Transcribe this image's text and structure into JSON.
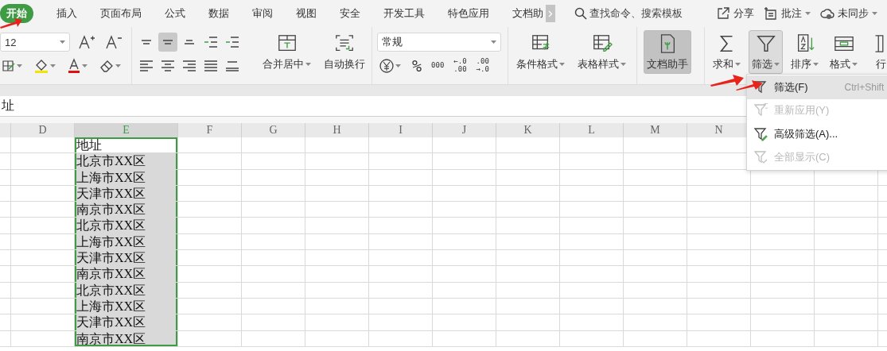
{
  "tabs": [
    {
      "label": "开始",
      "selected": true
    },
    {
      "label": "插入",
      "selected": false
    },
    {
      "label": "页面布局",
      "selected": false
    },
    {
      "label": "公式",
      "selected": false
    },
    {
      "label": "数据",
      "selected": false
    },
    {
      "label": "审阅",
      "selected": false
    },
    {
      "label": "视图",
      "selected": false
    },
    {
      "label": "安全",
      "selected": false
    },
    {
      "label": "开发工具",
      "selected": false
    },
    {
      "label": "特色应用",
      "selected": false
    },
    {
      "label": "文档助",
      "selected": false
    }
  ],
  "search": {
    "placeholder": "查找命令、搜索模板"
  },
  "top_actions": [
    {
      "kind": "share",
      "label": "分享",
      "dropdown": false
    },
    {
      "kind": "comment",
      "label": "批注",
      "dropdown": true
    },
    {
      "kind": "sync",
      "label": "未同步",
      "dropdown": true
    }
  ],
  "font_size": "12",
  "align_buttons": [
    {
      "kind": "top",
      "selected": false
    },
    {
      "kind": "middle",
      "selected": true
    },
    {
      "kind": "bottom",
      "selected": false
    },
    {
      "kind": "outdent",
      "selected": false
    },
    {
      "kind": "indent",
      "selected": false
    },
    {
      "kind": "left",
      "selected": false
    },
    {
      "kind": "center",
      "selected": false
    },
    {
      "kind": "right",
      "selected": false
    },
    {
      "kind": "justify",
      "selected": false
    },
    {
      "kind": "distribute",
      "selected": false
    }
  ],
  "number_format": "常规",
  "number_tools": [
    {
      "kind": "percent",
      "lines": [
        "%"
      ]
    },
    {
      "kind": "thousands",
      "lines": [
        "000"
      ]
    },
    {
      "kind": "more_decimals",
      "lines": [
        "←.0",
        ".00"
      ]
    },
    {
      "kind": "fewer_decimals",
      "lines": [
        ".00",
        "→.0"
      ]
    }
  ],
  "ribbon_buttons": [
    {
      "kind": "merge",
      "label": "合并居中",
      "dropdown": true,
      "selected": false
    },
    {
      "kind": "wrap",
      "label": "自动换行",
      "dropdown": false,
      "selected": false
    },
    {
      "kind": "conditional",
      "label": "条件格式",
      "dropdown": true,
      "selected": false
    },
    {
      "kind": "table_style",
      "label": "表格样式",
      "dropdown": true,
      "selected": false
    },
    {
      "kind": "assistant",
      "label": "文档助手",
      "dropdown": false,
      "selected": true
    },
    {
      "kind": "sum",
      "label": "求和",
      "dropdown": true,
      "selected": false
    },
    {
      "kind": "filter",
      "label": "筛选",
      "dropdown": true,
      "selected": true
    },
    {
      "kind": "sort",
      "label": "排序",
      "dropdown": true,
      "selected": false
    },
    {
      "kind": "format",
      "label": "格式",
      "dropdown": true,
      "selected": false
    },
    {
      "kind": "rows_cols",
      "label": "行",
      "dropdown": false,
      "selected": false
    }
  ],
  "formula_bar": {
    "value": "址"
  },
  "columns": [
    {
      "label": "D",
      "selected": false
    },
    {
      "label": "E",
      "selected": true
    },
    {
      "label": "F",
      "selected": false
    },
    {
      "label": "G",
      "selected": false
    },
    {
      "label": "H",
      "selected": false
    },
    {
      "label": "I",
      "selected": false
    },
    {
      "label": "J",
      "selected": false
    },
    {
      "label": "K",
      "selected": false
    },
    {
      "label": "L",
      "selected": false
    },
    {
      "label": "M",
      "selected": false
    },
    {
      "label": "N",
      "selected": false
    }
  ],
  "rows": [
    {
      "value": "地址",
      "selected": true,
      "active": true
    },
    {
      "value": "北京市XX区",
      "selected": true,
      "active": false
    },
    {
      "value": "上海市XX区",
      "selected": true,
      "active": false
    },
    {
      "value": "天津市XX区",
      "selected": true,
      "active": false
    },
    {
      "value": "南京市XX区",
      "selected": true,
      "active": false
    },
    {
      "value": "北京市XX区",
      "selected": true,
      "active": false
    },
    {
      "value": "上海市XX区",
      "selected": true,
      "active": false
    },
    {
      "value": "天津市XX区",
      "selected": true,
      "active": false
    },
    {
      "value": "南京市XX区",
      "selected": true,
      "active": false
    },
    {
      "value": "北京市XX区",
      "selected": true,
      "active": false
    },
    {
      "value": "上海市XX区",
      "selected": true,
      "active": false
    },
    {
      "value": "天津市XX区",
      "selected": true,
      "active": false
    },
    {
      "value": "南京市XX区",
      "selected": true,
      "active": false
    }
  ],
  "filter_menu": [
    {
      "kind": "filter",
      "label": "筛选(F)",
      "shortcut": "Ctrl+Shift",
      "disabled": false,
      "highlighted": true
    },
    {
      "kind": "reapply",
      "label": "重新应用(Y)",
      "disabled": true,
      "highlighted": false
    },
    {
      "kind": "advanced",
      "label": "高级筛选(A)...",
      "disabled": false,
      "highlighted": false
    },
    {
      "kind": "show_all",
      "label": "全部显示(C)",
      "disabled": true,
      "highlighted": false
    }
  ]
}
